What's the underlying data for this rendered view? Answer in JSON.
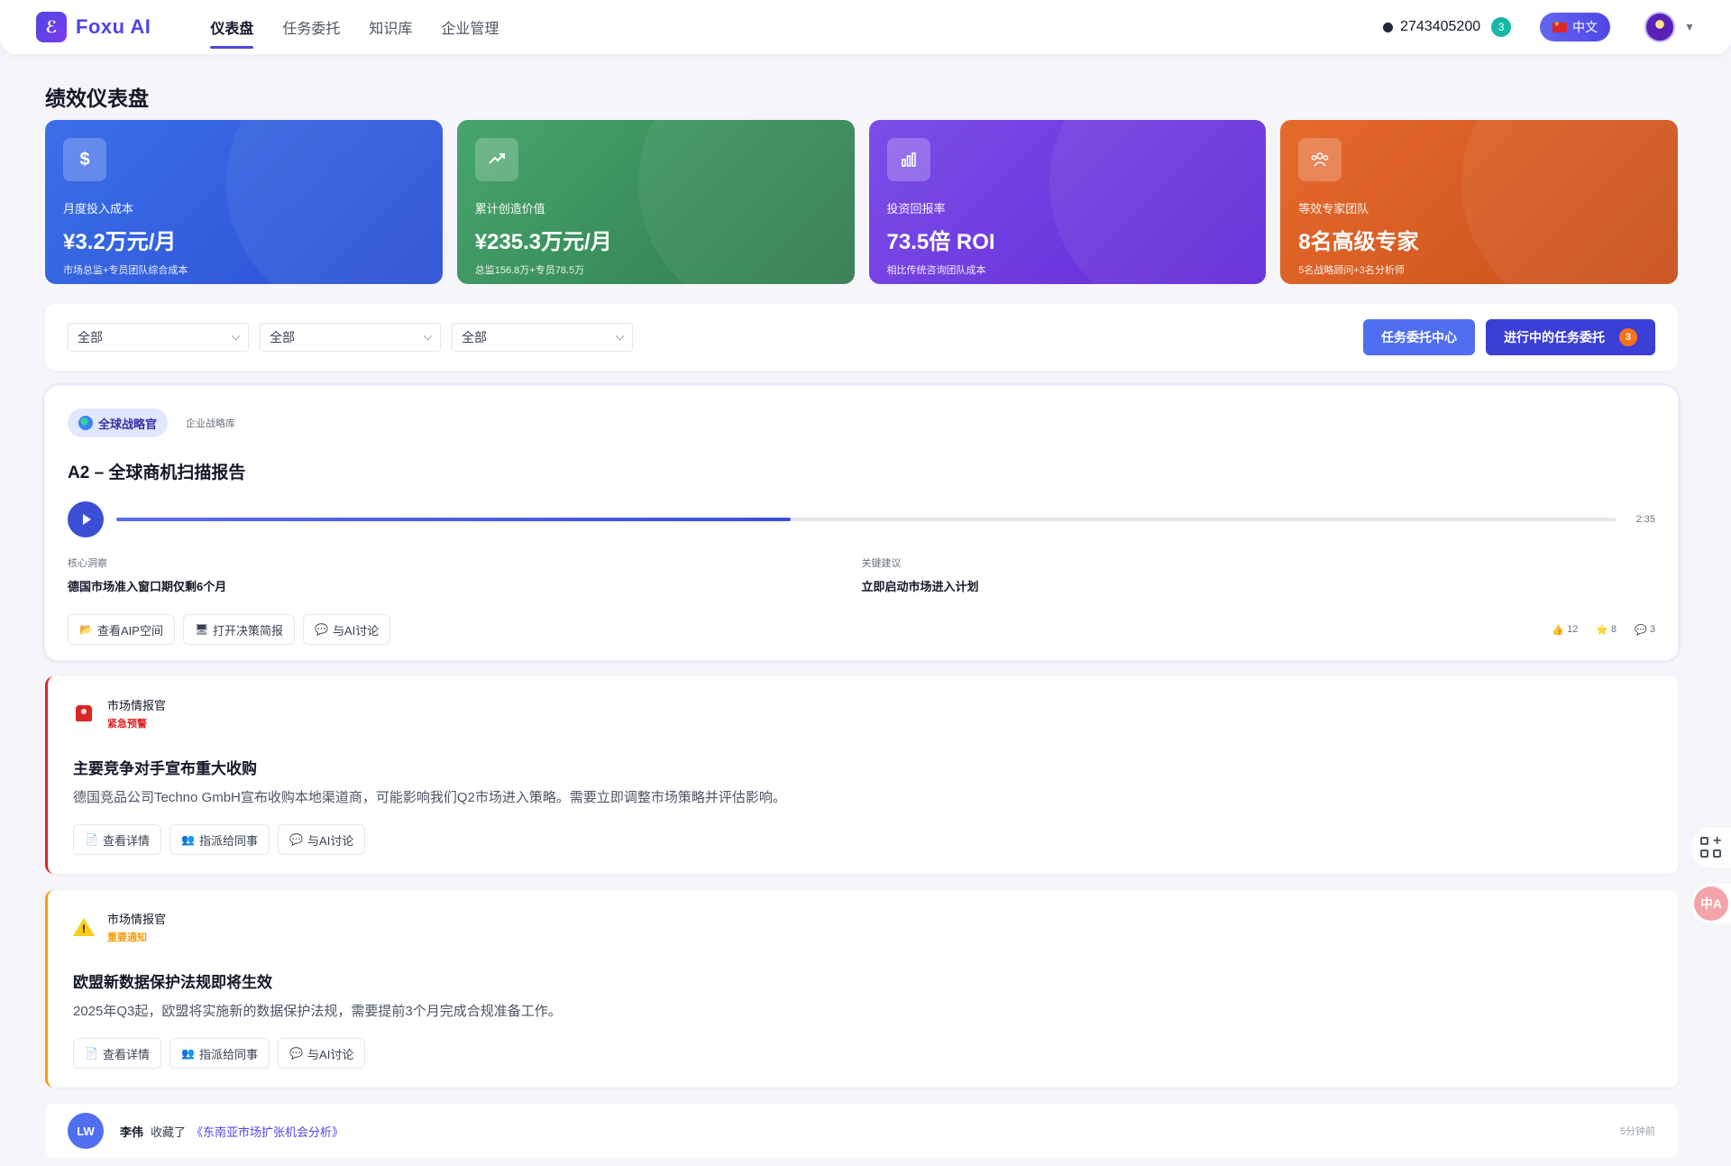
{
  "header": {
    "logo_text": "Foxu AI",
    "nav": [
      {
        "label": "仪表盘",
        "active": true
      },
      {
        "label": "任务委托",
        "active": false
      },
      {
        "label": "知识库",
        "active": false
      },
      {
        "label": "企业管理",
        "active": false
      }
    ],
    "account_id": "2743405200",
    "notification_count": "3",
    "language_label": "中文"
  },
  "page_title": "绩效仪表盘",
  "stats": [
    {
      "icon": "dollar-icon",
      "label": "月度投入成本",
      "value": "¥3.2万元/月",
      "sub": "市场总监+专员团队综合成本",
      "color": "#3b6fe8"
    },
    {
      "icon": "trend-up-icon",
      "label": "累计创造价值",
      "value": "¥235.3万元/月",
      "sub": "总监156.8万+专员78.5万",
      "color": "#47a56c"
    },
    {
      "icon": "bar-chart-icon",
      "label": "投资回报率",
      "value": "73.5倍 ROI",
      "sub": "相比传统咨询团队成本",
      "color": "#7c4ee8"
    },
    {
      "icon": "team-icon",
      "label": "等效专家团队",
      "value": "8名高级专家",
      "sub": "5名战略顾问+3名分析师",
      "color": "#e66a2c"
    }
  ],
  "filters": {
    "selects": [
      "全部",
      "全部",
      "全部"
    ],
    "task_center_label": "任务委托中心",
    "in_progress_label": "进行中的任务委托",
    "in_progress_count": "3"
  },
  "feature": {
    "tag": "全球战略官",
    "tag_secondary": "企业战略库",
    "title": "A2 – 全球商机扫描报告",
    "progress": 0.45,
    "duration": "2:35",
    "insight_label": "核心洞察",
    "insight_text": "德国市场准入窗口期仅剩6个月",
    "advice_label": "关键建议",
    "advice_text": "立即启动市场进入计划",
    "actions": [
      "查看AIP空间",
      "打开决策简报",
      "与AI讨论"
    ],
    "likes": "12",
    "stars": "8",
    "comments": "3"
  },
  "alerts": [
    {
      "source": "市场情报官",
      "level": "紧急预警",
      "title": "主要竞争对手宣布重大收购",
      "desc": "德国竞品公司Techno GmbH宣布收购本地渠道商，可能影响我们Q2市场进入策略。需要立即调整市场策略并评估影响。",
      "actions": [
        "查看详情",
        "指派给同事",
        "与AI讨论"
      ],
      "color": "#dc2626"
    },
    {
      "source": "市场情报官",
      "level": "重要通知",
      "title": "欧盟新数据保护法规即将生效",
      "desc": "2025年Q3起，欧盟将实施新的数据保护法规，需要提前3个月完成合规准备工作。",
      "actions": [
        "查看详情",
        "指派给同事",
        "与AI讨论"
      ],
      "color": "#f59e0b"
    }
  ],
  "activity": {
    "avatar": "LW",
    "user": "李伟",
    "verb": "收藏了",
    "link": "《东南亚市场扩张机会分析》",
    "time": "5分钟前"
  },
  "side": {
    "translate_label": "中A"
  }
}
